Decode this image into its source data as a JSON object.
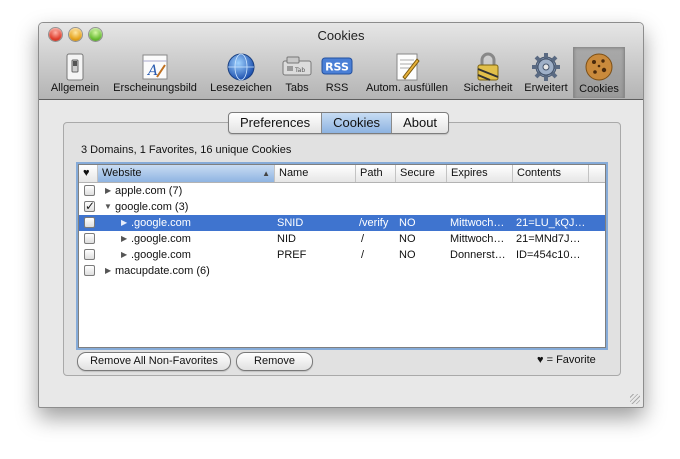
{
  "window": {
    "title": "Cookies"
  },
  "toolbar": {
    "items": [
      {
        "label": "Allgemein",
        "icon": "switch-icon"
      },
      {
        "label": "Erscheinungsbild",
        "icon": "font-panel-icon"
      },
      {
        "label": "Lesezeichen",
        "icon": "globe-icon"
      },
      {
        "label": "Tabs",
        "icon": "tabs-icon"
      },
      {
        "label": "RSS",
        "icon": "rss-icon",
        "badge_text": "RSS"
      },
      {
        "label": "Autom. ausfüllen",
        "icon": "pencil-form-icon"
      },
      {
        "label": "Sicherheit",
        "icon": "padlock-icon"
      },
      {
        "label": "Erweitert",
        "icon": "gear-icon"
      },
      {
        "label": "Cookies",
        "icon": "cookie-icon"
      }
    ],
    "selected": "Cookies"
  },
  "tabs": [
    {
      "label": "Preferences"
    },
    {
      "label": "Cookies"
    },
    {
      "label": "About"
    }
  ],
  "active_tab": "Cookies",
  "summary": "3 Domains, 1 Favorites, 16 unique Cookies",
  "table": {
    "columns": [
      "♥",
      "Website",
      "Name",
      "Path",
      "Secure",
      "Expires",
      "Contents"
    ],
    "sorted_column": "Website",
    "rows": [
      {
        "favorite": false,
        "website": "apple.com (7)",
        "expanded": false,
        "name": "",
        "path": "",
        "secure": "",
        "expires": "",
        "contents": ""
      },
      {
        "favorite": true,
        "website": "google.com (3)",
        "expanded": true,
        "name": "",
        "path": "",
        "secure": "",
        "expires": "",
        "contents": ""
      },
      {
        "favorite": false,
        "website": ".google.com",
        "expanded": false,
        "name": "SNID",
        "path": "/verify",
        "secure": "NO",
        "expires": "Mittwoch…",
        "contents": "21=LU_kQJ…",
        "selected": true
      },
      {
        "favorite": false,
        "website": ".google.com",
        "expanded": false,
        "name": "NID",
        "path": "/",
        "secure": "NO",
        "expires": "Mittwoch…",
        "contents": "21=MNd7J…"
      },
      {
        "favorite": false,
        "website": ".google.com",
        "expanded": false,
        "name": "PREF",
        "path": "/",
        "secure": "NO",
        "expires": "Donnerst…",
        "contents": "ID=454c10…"
      },
      {
        "favorite": false,
        "website": "macupdate.com (6)",
        "expanded": false,
        "name": "",
        "path": "",
        "secure": "",
        "expires": "",
        "contents": ""
      }
    ]
  },
  "buttons": {
    "remove_non_favorites": "Remove All Non-Favorites",
    "remove": "Remove"
  },
  "legend": "♥ = Favorite",
  "colors": {
    "selection": "#3f74cf",
    "active_tab": "#8db3e1"
  }
}
